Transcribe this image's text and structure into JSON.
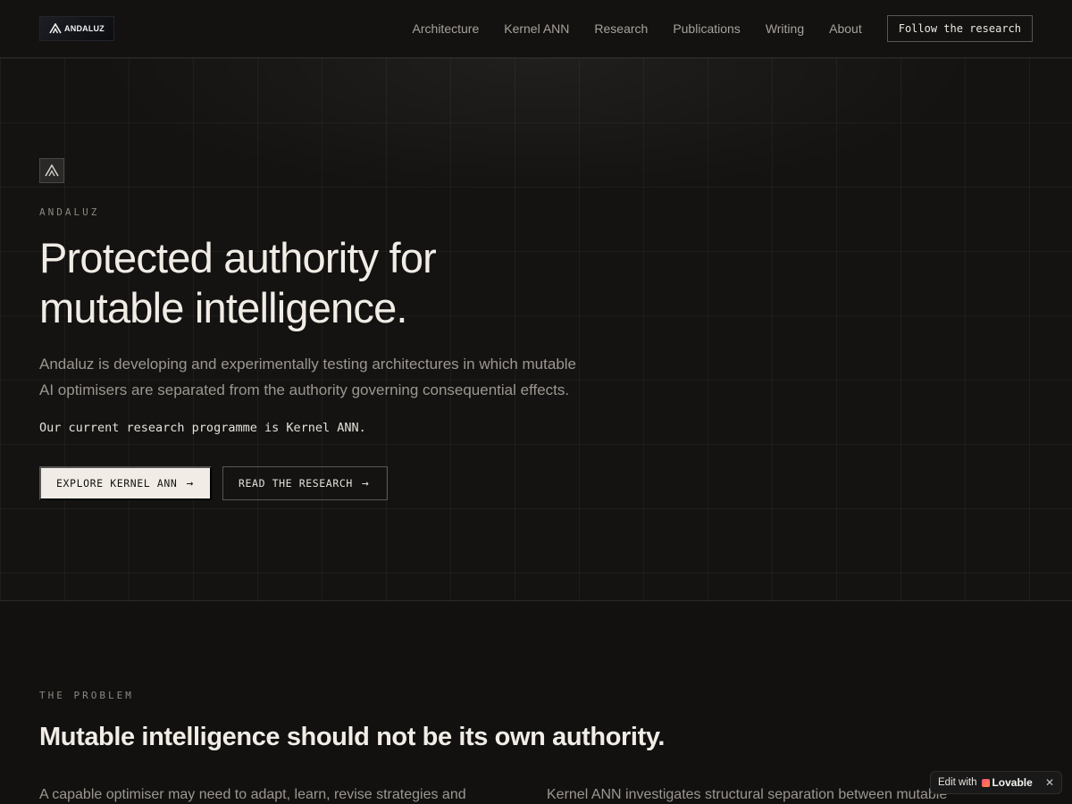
{
  "nav": {
    "logo_text": "ANDALUZ",
    "links": [
      "Architecture",
      "Kernel ANN",
      "Research",
      "Publications",
      "Writing",
      "About"
    ],
    "cta": "Follow the research"
  },
  "hero": {
    "eyebrow": "ANDALUZ",
    "title_lines": [
      "Protected authority for",
      "mutable intelligence."
    ],
    "description_lines": [
      "Andaluz is developing and experimentally testing architectures in which mutable",
      "AI optimisers are separated from the authority governing consequential effects."
    ],
    "mono_line": "Our current research programme is Kernel ANN.",
    "primary_button": "EXPLORE KERNEL ANN",
    "secondary_button": "READ THE RESEARCH"
  },
  "problem": {
    "eyebrow": "THE PROBLEM",
    "title": "Mutable intelligence should not be its own authority.",
    "left_text": "A capable optimiser may need to adapt, learn, revise strategies and",
    "right_text": "Kernel ANN investigates structural separation between mutable"
  },
  "badge": {
    "label": "Edit with",
    "brand": "Lovable",
    "close": "✕"
  },
  "colors": {
    "background": "#121110",
    "text": "#ece8e1",
    "muted": "#9c978f",
    "button_light": "#f1ede6"
  }
}
